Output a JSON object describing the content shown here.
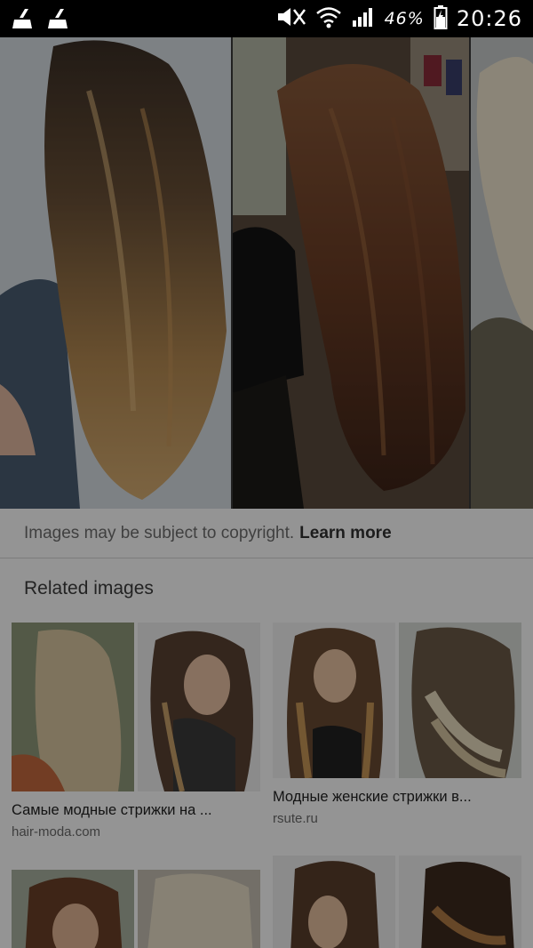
{
  "status_bar": {
    "left_icons": [
      "broom-icon",
      "broom-icon"
    ],
    "battery_percent": "46%",
    "time": "20:26"
  },
  "hero": {
    "images": [
      {
        "name": "hero-image-ombre-long-hair"
      },
      {
        "name": "hero-image-brown-layered-hair"
      },
      {
        "name": "hero-image-blonde-hair-partial"
      }
    ]
  },
  "notice": {
    "text": "Images may be subject to copyright.",
    "link": "Learn more"
  },
  "related": {
    "title": "Related images",
    "cards": [
      {
        "title": "Самые модные стрижки на ...",
        "source": "hair-moda.com"
      },
      {
        "title": "Модные женские стрижки в...",
        "source": "rsute.ru"
      }
    ]
  }
}
